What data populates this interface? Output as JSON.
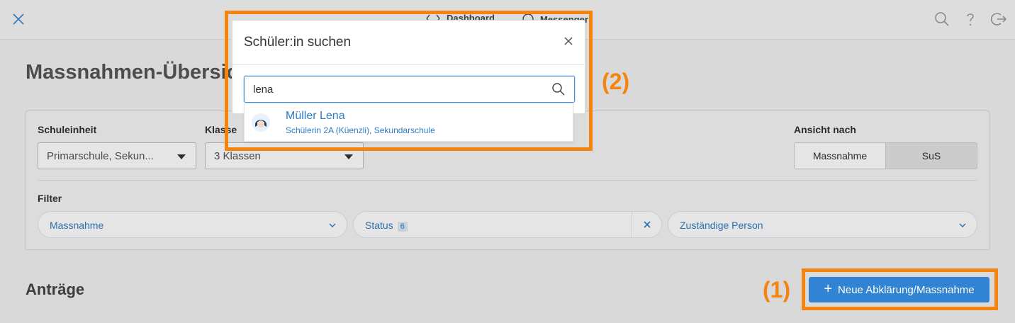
{
  "topbar": {
    "nav": [
      "Dashboard",
      "Messenger"
    ]
  },
  "page": {
    "title": "Massnahmen-Übersicht"
  },
  "filters": {
    "schuleinheit_label": "Schuleinheit",
    "schuleinheit_value": "Primarschule, Sekun...",
    "klasse_label": "Klasse",
    "klasse_value": "3 Klassen",
    "ansicht_label": "Ansicht nach",
    "ansicht_options": [
      "Massnahme",
      "SuS"
    ],
    "ansicht_selected": "Massnahme",
    "filter_label": "Filter",
    "chips": {
      "massnahme": "Massnahme",
      "status": "Status",
      "status_count": "6",
      "person": "Zuständige Person"
    }
  },
  "main": {
    "section_title": "Anträge",
    "new_button": "Neue Abklärung/Massnahme"
  },
  "modal": {
    "title": "Schüler:in suchen",
    "search_value": "lena",
    "results": [
      {
        "name": "Müller Lena",
        "detail": "Schülerin 2A (Küenzli), Sekundarschule"
      }
    ]
  },
  "callouts": [
    "(1)",
    "(2)"
  ],
  "colors": {
    "accent": "#3184d4",
    "highlight": "#f5840f",
    "link": "#2f7dc2"
  }
}
